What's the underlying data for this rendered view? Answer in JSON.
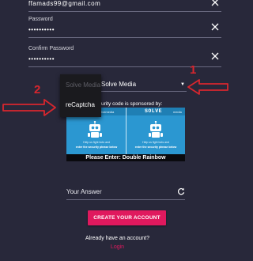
{
  "form": {
    "email": {
      "value": "ffamads99@gmail.com"
    },
    "password": {
      "label": "Password",
      "value": "••••••••••"
    },
    "confirm_password": {
      "label": "Confirm Password",
      "value": "••••••••••"
    },
    "captcha_type": {
      "selected": "Solve Media",
      "options": [
        "Solve Media",
        "reCaptcha"
      ]
    },
    "captcha": {
      "sponsor_text": "Security code is sponsored by:",
      "sponsor_text_visible": "urity code is sponsored by:",
      "brand": "SOLVE",
      "brand_suffix": "media",
      "tag": "solvemedia",
      "help_text": "Help us fight bots and",
      "enter_text": "enter the security phrase below",
      "phrase_label": "Please Enter:",
      "phrase": "Double Rainbow"
    },
    "answer": {
      "placeholder": "Your Answer"
    },
    "submit_label": "CREATE YOUR ACCOUNT",
    "have_account_text": "Already have an account?",
    "login_label": "Login"
  },
  "annotations": {
    "marker_1": "1",
    "marker_2": "2",
    "arrow_color": "#d8262e"
  },
  "colors": {
    "background": "#28283a",
    "accent": "#e0195e",
    "captcha_blue": "#2b97d1"
  }
}
